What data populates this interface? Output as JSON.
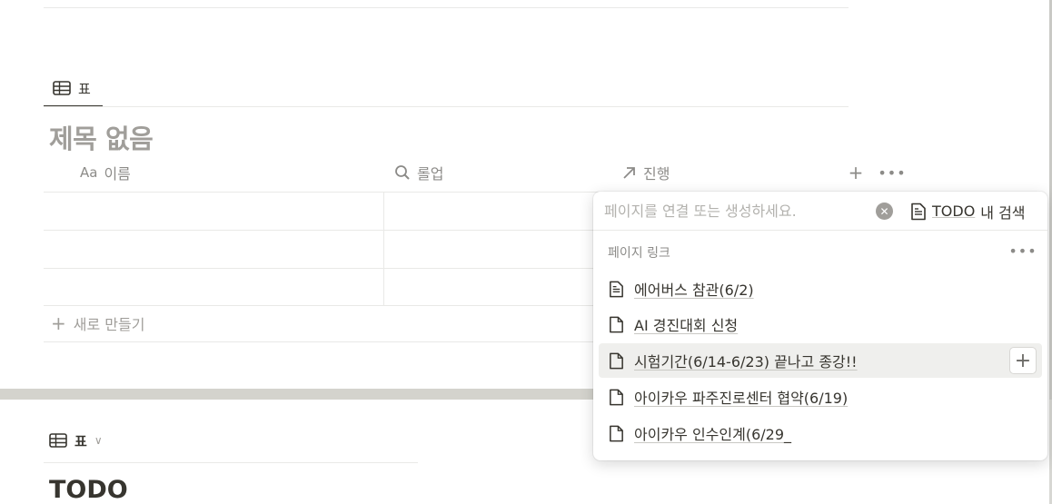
{
  "top_view": {
    "tab_label": "표",
    "title": "제목 없음",
    "columns": [
      {
        "label": "이름",
        "icon_text": "Aa",
        "icon": "text-type-icon"
      },
      {
        "label": "롤업",
        "icon": "search-icon"
      },
      {
        "label": "진행",
        "icon": "arrow-up-right-icon"
      }
    ],
    "add_column_icon": "plus-icon",
    "more_icon": "ellipsis-icon",
    "new_row_label": "새로 만들기"
  },
  "bottom_view": {
    "tab_label": "표",
    "title": "TODO"
  },
  "relation_popup": {
    "search_placeholder": "페이지를 연결 또는 생성하세요.",
    "search_value": "",
    "scope_db": "TODO",
    "scope_suffix": "내 검색",
    "section_label": "페이지 링크",
    "items": [
      {
        "label": "에어버스 참관(6/2)",
        "icon": "page-text-icon"
      },
      {
        "label": "AI 경진대회 신청",
        "icon": "page-icon"
      },
      {
        "label": "시험기간(6/14-6/23) 끝나고 종강!!",
        "icon": "page-icon",
        "hovered": true
      },
      {
        "label": "아이카우 파주진로센터 협약(6/19)",
        "icon": "page-icon"
      },
      {
        "label": "아이카우 인수인계(6/29_",
        "icon": "page-icon"
      }
    ]
  }
}
